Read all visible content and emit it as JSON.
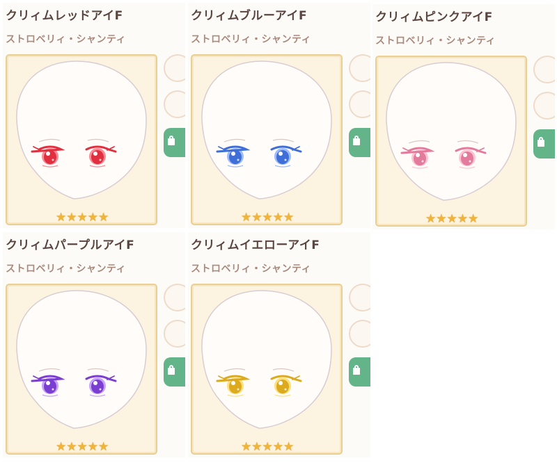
{
  "items": [
    {
      "name": "クリィムレッドアイF",
      "brand": "ストロベリィ・シャンティ",
      "rarity": 5,
      "icon": "face-eye-preview-icon",
      "eye_color": "#e0303f",
      "eye_light": "#ff8a95"
    },
    {
      "name": "クリィムブルーアイF",
      "brand": "ストロベリィ・シャンティ",
      "rarity": 5,
      "icon": "face-eye-preview-icon",
      "eye_color": "#3f6fd6",
      "eye_light": "#9cbcff"
    },
    {
      "name": "クリィムピンクアイF",
      "brand": "ストロベリィ・シャンティ",
      "rarity": 5,
      "icon": "face-eye-preview-icon",
      "eye_color": "#e37c9c",
      "eye_light": "#ffc4d4"
    },
    {
      "name": "クリィムパープルアイF",
      "brand": "ストロベリィ・シャンティ",
      "rarity": 5,
      "icon": "face-eye-preview-icon",
      "eye_color": "#7a3ed0",
      "eye_light": "#c7a2ff"
    },
    {
      "name": "クリィムイエローアイF",
      "brand": "ストロベリィ・シャンティ",
      "rarity": 5,
      "icon": "face-eye-preview-icon",
      "eye_color": "#dcaa1e",
      "eye_light": "#ffe07a"
    }
  ],
  "colors": {
    "frame_border": "#e9cf93",
    "frame_bg": "#fcf3e0",
    "star": "#f0b43a",
    "action_green": "#63b489"
  }
}
